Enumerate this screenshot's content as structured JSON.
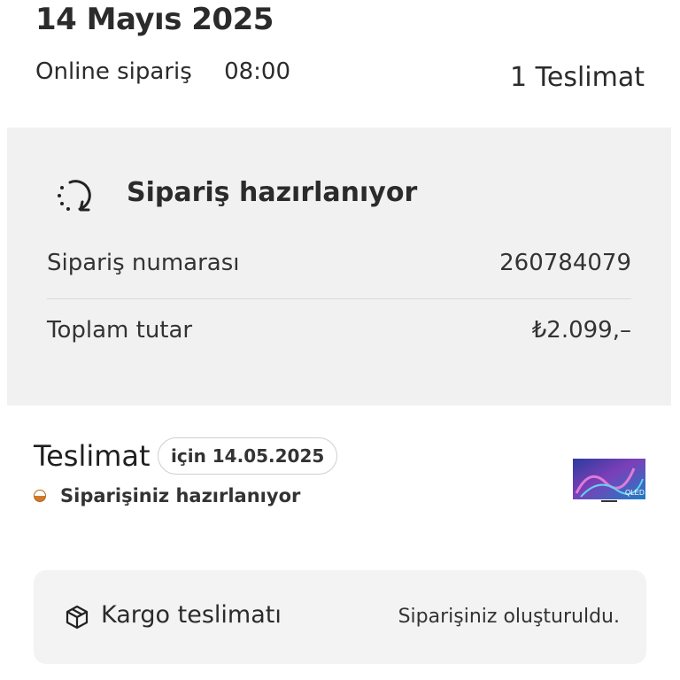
{
  "header": {
    "date": "14 Mayıs 2025",
    "order_type": "Online sipariş",
    "order_time": "08:00",
    "delivery_count": "1 Teslimat"
  },
  "status_panel": {
    "title": "Sipariş hazırlanıyor",
    "icon": "loading-refresh-icon",
    "rows": [
      {
        "label": "Sipariş numarası",
        "value": "260784079"
      },
      {
        "label": "Toplam tutar",
        "value": "₺2.099,–"
      }
    ]
  },
  "delivery": {
    "title": "Teslimat",
    "date_chip": "için 14.05.2025",
    "status_text": "Siparişiniz hazırlanıyor",
    "status_color": "#d2792b",
    "product_image": "qled-tv-thumbnail",
    "product_badge": "QLED"
  },
  "shipping": {
    "icon": "package-box-icon",
    "label": "Kargo teslimatı",
    "status": "Siparişiniz oluşturuldu."
  }
}
